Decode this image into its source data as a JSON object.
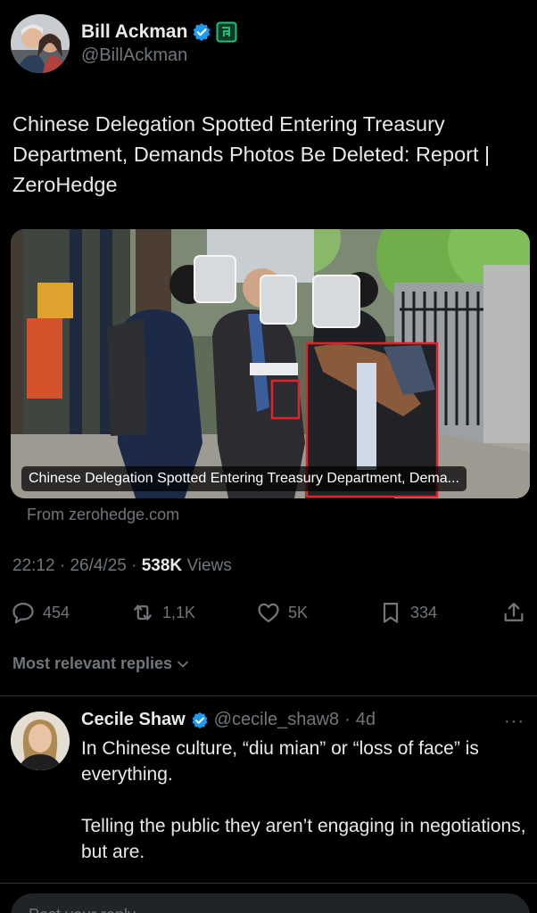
{
  "author": {
    "name": "Bill Ackman",
    "handle": "@BillAckman"
  },
  "tweet": {
    "text": "Chinese Delegation Spotted Entering Treasury Department, Demands Photos Be Deleted: Report | ZeroHedge",
    "card_caption": "Chinese Delegation Spotted Entering Treasury Department, Dema...",
    "card_source": "From zerohedge.com",
    "time": "22:12",
    "date": "26/4/25",
    "views_count": "538K",
    "views_label": "Views"
  },
  "actions": {
    "replies": "454",
    "reposts": "1,1K",
    "likes": "5K",
    "bookmarks": "334"
  },
  "replies_section": {
    "label": "Most relevant replies"
  },
  "reply": {
    "name": "Cecile Shaw",
    "handle": "@cecile_shaw8",
    "age": "4d",
    "text": "In Chinese culture, “diu mian” or “loss of face” is everything.\n\nTelling the public they aren’t engaging in negotiations, but are."
  },
  "composer": {
    "placeholder": "Post your reply"
  },
  "colors": {
    "background": "#000000",
    "text": "#e7e9ea",
    "muted": "#71767b",
    "verified": "#1d9bf0",
    "highlight_box": "#e0242b"
  }
}
